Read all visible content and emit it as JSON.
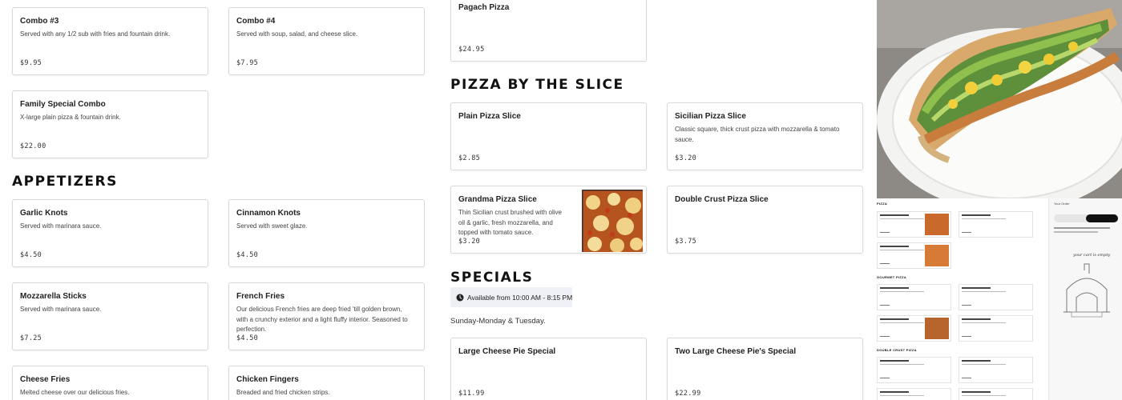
{
  "left_column": {
    "items": [
      {
        "name": "Combo #3",
        "desc": "Served with any 1/2 sub with fries and fountain drink.",
        "price": "$9.95"
      },
      {
        "name": "Combo #4",
        "desc": "Served with soup, salad, and cheese slice.",
        "price": "$7.95"
      },
      {
        "name": "Family Special Combo",
        "desc": "X-large plain pizza & fountain drink.",
        "price": "$22.00"
      }
    ],
    "appetizers_title": "Appetizers",
    "appetizers": [
      {
        "name": "Garlic Knots",
        "desc": "Served with marinara sauce.",
        "price": "$4.50"
      },
      {
        "name": "Cinnamon Knots",
        "desc": "Served with sweet glaze.",
        "price": "$4.50"
      },
      {
        "name": "Mozzarella Sticks",
        "desc": "Served with marinara sauce.",
        "price": "$7.25"
      },
      {
        "name": "French Fries",
        "desc": "Our delicious French fries are deep fried 'till golden brown, with a crunchy exterior and a light fluffy interior. Seasoned to perfection.",
        "price": "$4.50"
      },
      {
        "name": "Cheese Fries",
        "desc": "Melted cheese over our delicious fries.",
        "price": ""
      },
      {
        "name": "Chicken Fingers",
        "desc": "Breaded and fried chicken strips.",
        "price": ""
      }
    ]
  },
  "middle_column": {
    "pagach": {
      "name": "Pagach Pizza",
      "price": "$24.95"
    },
    "slice_title": "Pizza by the Slice",
    "slices": [
      {
        "name": "Plain Pizza Slice",
        "desc": "",
        "price": "$2.85"
      },
      {
        "name": "Sicilian Pizza Slice",
        "desc": "Classic square, thick crust pizza with mozzarella & tomato sauce.",
        "price": "$3.20"
      },
      {
        "name": "Grandma Pizza Slice",
        "desc": "Thin Sicilian crust brushed with olive oil & garlic, fresh mozzarella, and topped with tomato sauce.",
        "price": "$3.20"
      },
      {
        "name": "Double Crust Pizza Slice",
        "desc": "",
        "price": "$3.75"
      }
    ],
    "specials_title": "Specials",
    "hours": "Available from 10:00 AM - 8:15 PM",
    "days": "Sunday-Monday & Tuesday.",
    "specials": [
      {
        "name": "Large Cheese Pie Special",
        "price": "$11.99"
      },
      {
        "name": "Two Large Cheese Pie's Special",
        "price": "$22.99"
      }
    ]
  },
  "preview": {
    "sections": [
      "PIZZA",
      "GOURMET PIZZA",
      "DOUBLE CRUST PIZZA"
    ],
    "order_header": "Your Order",
    "empty_cart": "your cart is empty"
  },
  "colors": {
    "accent": "#111111",
    "hours_bg": "#eef0f5",
    "border": "#d9d9d9"
  }
}
